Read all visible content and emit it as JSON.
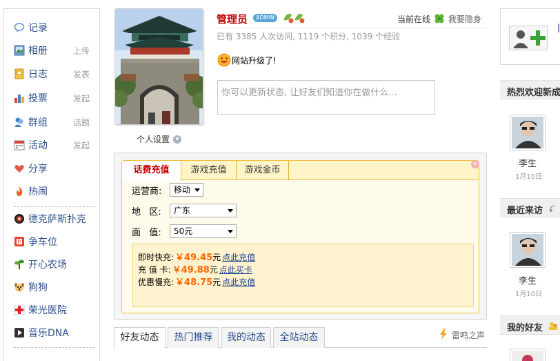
{
  "sidebar": {
    "items": [
      {
        "label": "记录",
        "action": "",
        "icon": "record-icon"
      },
      {
        "label": "相册",
        "action": "上传",
        "icon": "photo-album-icon"
      },
      {
        "label": "日志",
        "action": "发表",
        "icon": "blog-icon"
      },
      {
        "label": "投票",
        "action": "发起",
        "icon": "poll-icon"
      },
      {
        "label": "群组",
        "action": "话题",
        "icon": "group-icon"
      },
      {
        "label": "活动",
        "action": "发起",
        "icon": "event-icon"
      },
      {
        "label": "分享",
        "action": "",
        "icon": "share-icon"
      },
      {
        "label": "热闹",
        "action": "",
        "icon": "hot-icon"
      }
    ],
    "apps": [
      {
        "label": "德克萨斯扑克",
        "icon": "poker-icon"
      },
      {
        "label": "争车位",
        "icon": "parking-icon"
      },
      {
        "label": "开心农场",
        "icon": "farm-icon"
      },
      {
        "label": "狗狗",
        "icon": "dog-icon"
      },
      {
        "label": "荣光医院",
        "icon": "hospital-icon"
      },
      {
        "label": "音乐DNA",
        "icon": "music-icon"
      }
    ]
  },
  "profile": {
    "settings_label": "个人设置",
    "username": "管理员",
    "admin_badge": "ADMIN",
    "online_status": "当前在线",
    "hide_label": "我要隐身",
    "stats": "已有  3385 人次访问, 1119 个积分, 1039 个经验",
    "status_message": "网站升级了!",
    "status_placeholder": "你可以更新状态, 让好友们知道你在做什么..."
  },
  "recharge": {
    "tabs": [
      "话费充值",
      "游戏充值",
      "游戏金币"
    ],
    "close_label": "×",
    "carrier_label": "运营商:",
    "carrier_value": "移动",
    "region_label": "地   区:",
    "region_value": "广东",
    "amount_label": "面   值:",
    "amount_value": "50元",
    "prices": [
      {
        "label": "即时快充:",
        "amount": "￥49.45",
        "unit": "元",
        "link": "点此充值"
      },
      {
        "label": "充 值 卡:",
        "amount": "￥49.88",
        "unit": "元",
        "link": "点此买卡"
      },
      {
        "label": "优惠慢充:",
        "amount": "￥48.75",
        "unit": "元",
        "link": "点此充值"
      }
    ]
  },
  "feed": {
    "tabs": [
      "好友动态",
      "热门推荐",
      "我的动态",
      "全站动态"
    ],
    "thunder_label": "雷鸣之声"
  },
  "right": {
    "welcome_title": "热烈欢迎新成",
    "recent_title": "最近来访",
    "friends_title": "我的好友",
    "welcome_friend": {
      "name": "李生",
      "date": "1月10日"
    },
    "recent_friend": {
      "name": "李生",
      "date": "1月10日"
    }
  },
  "colors": {
    "link_blue": "#2b4f8c",
    "username_red": "#c00000",
    "price_orange": "#ff6600",
    "tab_border": "#f0c040"
  }
}
